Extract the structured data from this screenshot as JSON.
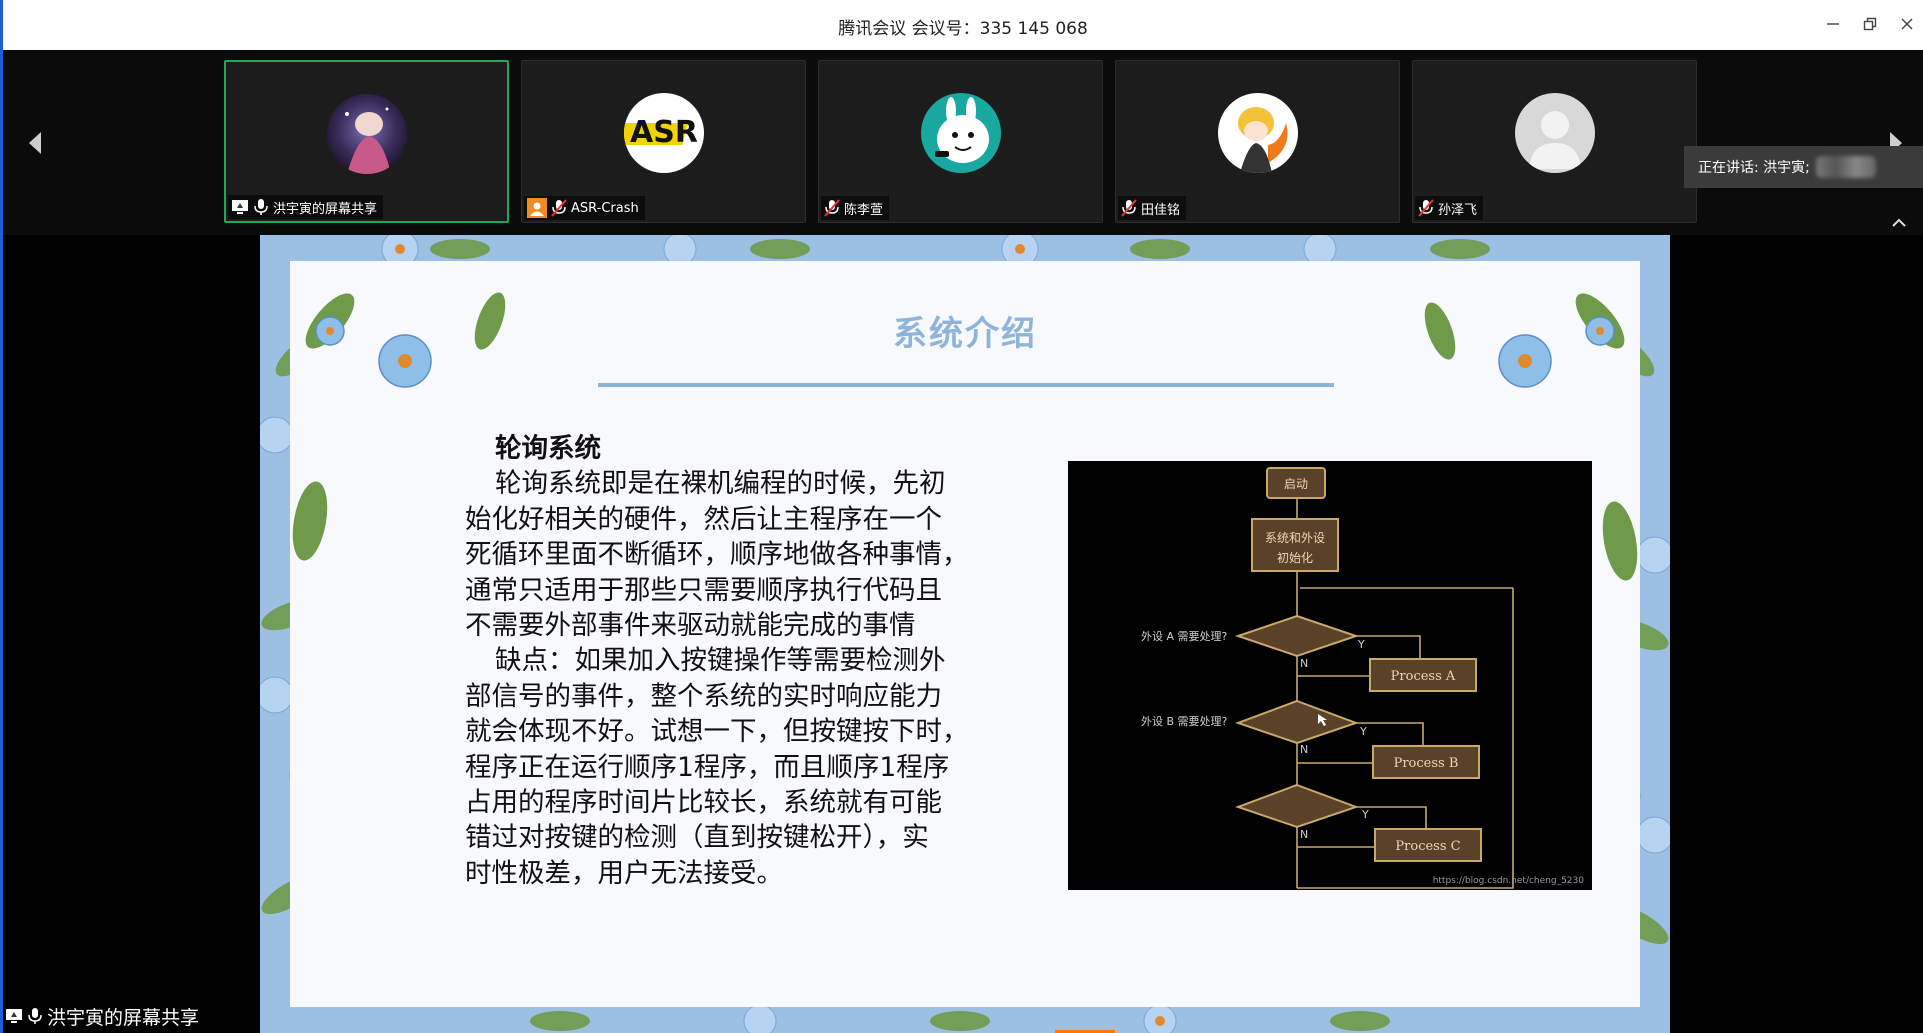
{
  "window": {
    "title": "腾讯会议 会议号：335 145 068"
  },
  "participants": [
    {
      "name": "洪宇寅的屏幕共享",
      "active": true
    },
    {
      "name": "ASR-Crash",
      "active": false
    },
    {
      "name": "陈李萱",
      "active": false
    },
    {
      "name": "田佳铭",
      "active": false
    },
    {
      "name": "孙泽飞",
      "active": false
    }
  ],
  "speaking": {
    "label": "正在讲话: 洪宇寅;"
  },
  "slide": {
    "title": "系统介绍",
    "heading": "轮询系统",
    "lines": [
      "轮询系统即是在裸机编程的时候，先初",
      "始化好相关的硬件，然后让主程序在一个",
      "死循环里面不断循环，顺序地做各种事情，",
      "通常只适用于那些只需要顺序执行代码且",
      "不需要外部事件来驱动就能完成的事情",
      "缺点：如果加入按键操作等需要检测外",
      "部信号的事件，整个系统的实时响应能力",
      "就会体现不好。试想一下，但按键按下时，",
      "程序正在运行顺序1程序，而且顺序1程序",
      "占用的程序时间片比较长，系统就有可能",
      "错过对按键的检测（直到按键松开），实",
      "时性极差，用户无法接受。"
    ],
    "flowchart": {
      "start": "启动",
      "init_line1": "系统和外设",
      "init_line2": "初始化",
      "q_a": "外设 A 需要处理?",
      "q_b": "外设 B 需要处理?",
      "yes": "Y",
      "no": "N",
      "proc_a": "Process A",
      "proc_b": "Process B",
      "proc_c": "Process C",
      "watermark": "https://blog.csdn.net/cheng_5230"
    }
  },
  "share_label": "洪宇寅的屏幕共享"
}
